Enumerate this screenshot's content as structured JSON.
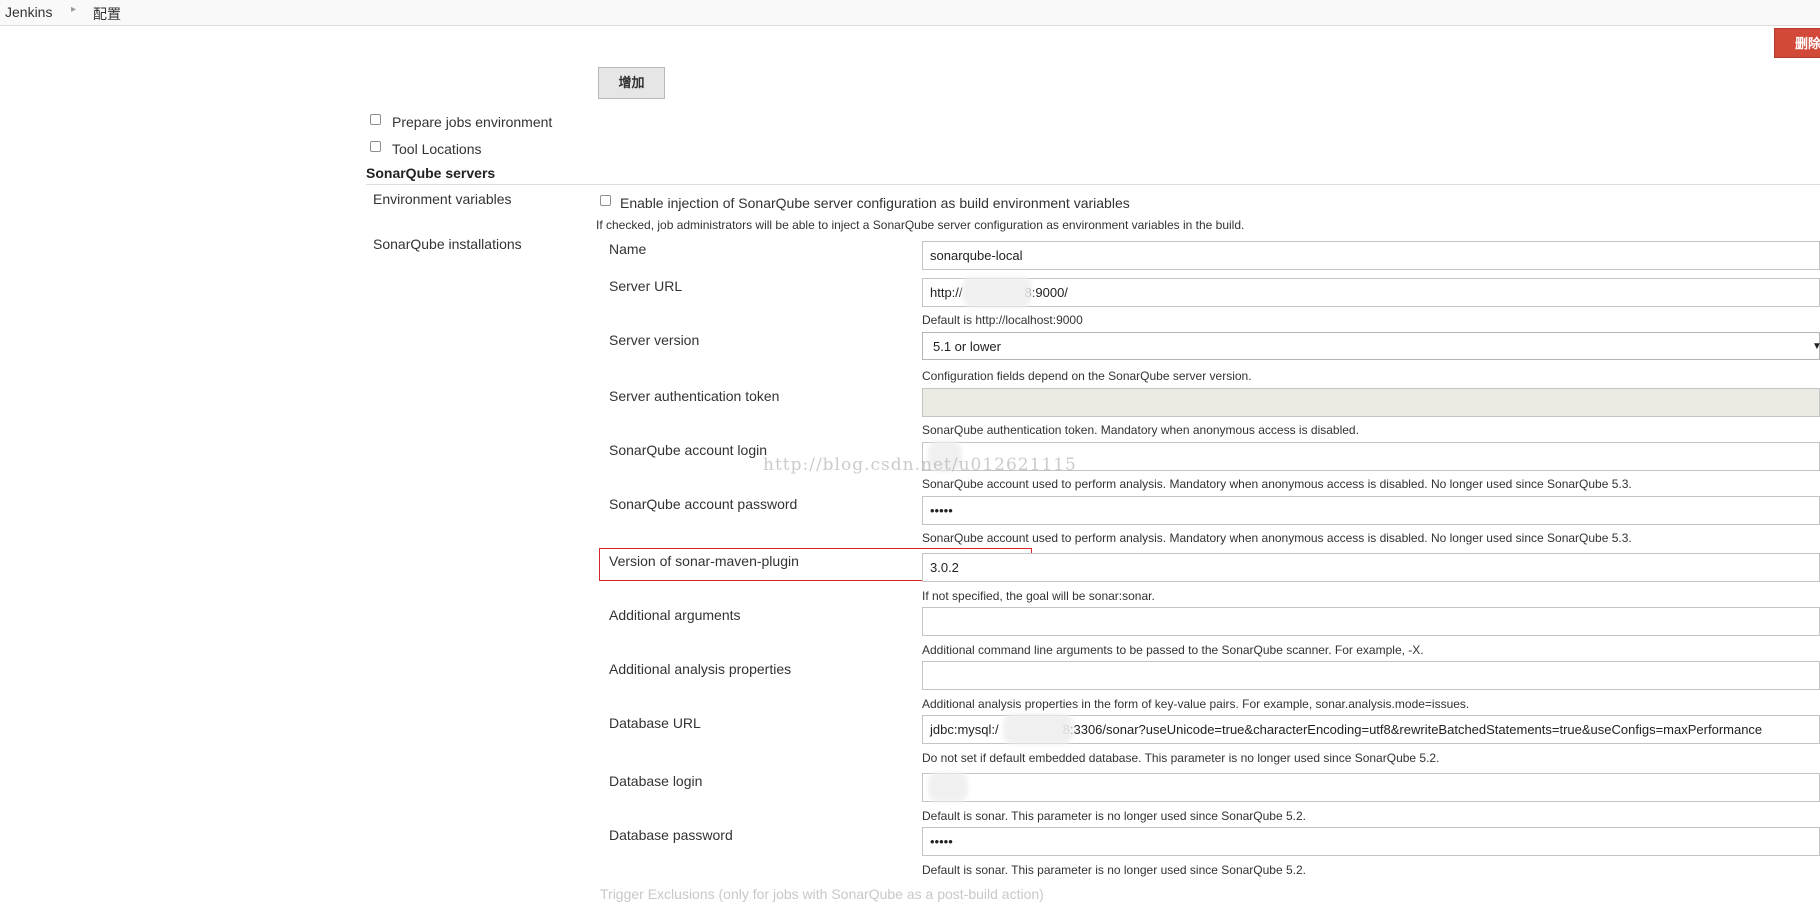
{
  "breadcrumb": {
    "root": "Jenkins",
    "current": "配置"
  },
  "toolbar": {
    "delete_label": "删除",
    "add_label": "增加"
  },
  "options": {
    "prepare_jobs_environment": "Prepare jobs environment",
    "tool_locations": "Tool Locations"
  },
  "sonarqube": {
    "section_title": "SonarQube servers",
    "env_vars_label": "Environment variables",
    "env_vars_checkbox": "Enable injection of SonarQube server configuration as build environment variables",
    "env_vars_help": "If checked, job administrators will be able to inject a SonarQube server configuration as environment variables in the build.",
    "installations_label": "SonarQube installations"
  },
  "fields": {
    "name": {
      "label": "Name",
      "value": "sonarqube-local"
    },
    "server_url": {
      "label": "Server URL",
      "value_prefix": "http://",
      "value_suffix": "8:9000/",
      "help": "Default is http://localhost:9000"
    },
    "server_version": {
      "label": "Server version",
      "value": "5.1 or lower",
      "help": "Configuration fields depend on the SonarQube server version."
    },
    "auth_token": {
      "label": "Server authentication token",
      "help": "SonarQube authentication token. Mandatory when anonymous access is disabled."
    },
    "account_login": {
      "label": "SonarQube account login",
      "help": "SonarQube account used to perform analysis. Mandatory when anonymous access is disabled. No longer used since SonarQube 5.3."
    },
    "account_password": {
      "label": "SonarQube account password",
      "value": "•••••",
      "help": "SonarQube account used to perform analysis. Mandatory when anonymous access is disabled. No longer used since SonarQube 5.3."
    },
    "maven_plugin": {
      "label": "Version of sonar-maven-plugin",
      "value": "3.0.2",
      "help": "If not specified, the goal will be sonar:sonar."
    },
    "additional_args": {
      "label": "Additional arguments",
      "help": "Additional command line arguments to be passed to the SonarQube scanner. For example, -X."
    },
    "analysis_props": {
      "label": "Additional analysis properties",
      "help": "Additional analysis properties in the form of key-value pairs. For example, sonar.analysis.mode=issues."
    },
    "db_url": {
      "label": "Database URL",
      "value_prefix": "jdbc:mysql:/",
      "value_suffix": "8:3306/sonar?useUnicode=true&characterEncoding=utf8&rewriteBatchedStatements=true&useConfigs=maxPerformance",
      "help": "Do not set if default embedded database. This parameter is no longer used since SonarQube 5.2."
    },
    "db_login": {
      "label": "Database login",
      "help": "Default is sonar. This parameter is no longer used since SonarQube 5.2."
    },
    "db_password": {
      "label": "Database password",
      "value": "•••••",
      "help": "Default is sonar. This parameter is no longer used since SonarQube 5.2."
    }
  },
  "footer_faded": "Trigger Exclusions (only for jobs with SonarQube as a post-build action)",
  "watermark": "http://blog.csdn.net/u012621115",
  "colors": {
    "highlight": "#d9262d",
    "delete_button": "#d24939"
  }
}
